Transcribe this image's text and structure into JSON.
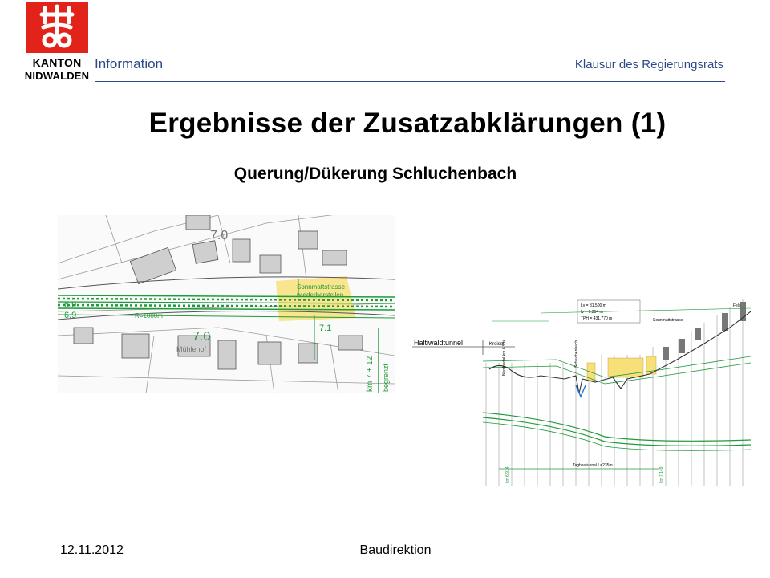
{
  "logo": {
    "line1": "KANTON",
    "line2": "NIDWALDEN"
  },
  "header": {
    "section": "Information",
    "meeting": "Klausur des Regierungsrats"
  },
  "slide": {
    "title": "Ergebnisse der Zusatzabklärungen (1)",
    "subtitle": "Querung/Dükerung Schluchenbach"
  },
  "map": {
    "km_labels": [
      "6.9",
      "7.0",
      "7.0",
      "7.1"
    ],
    "radius_label": "R=1000m",
    "street_label": "Sonnmattstrasse wiederherstellen",
    "street_label_lines": [
      "Sonnmattstrasse",
      "wiederherstellen"
    ],
    "place_label": "Mühlehof",
    "km_vertical": "km 7 + 12",
    "road_vertical": "begrenzt"
  },
  "profile": {
    "tunnel_label": "Haltiwaldtunnel",
    "kreisel_label": "Kreisel",
    "creek_label": "Schluchenbach",
    "street_label": "Sonnmattstrasse",
    "tagbau_label": "Tagbautunnel L=235m",
    "km_start": "km 6.914",
    "km_end": "km 7.149",
    "params": [
      "Lv = 31.500 m",
      "fv = 0.354 m",
      "TPH = 431.770 m"
    ],
    "portal_label": "Nordportal km 6.914",
    "fels_label": "Fels"
  },
  "footer": {
    "date": "12.11.2012",
    "department": "Baudirektion"
  },
  "colors": {
    "brand_red": "#e2231a",
    "header_blue": "#2b4a86",
    "alignment_green": "#1e9a3a",
    "highlight_yellow": "#f7e07a"
  }
}
